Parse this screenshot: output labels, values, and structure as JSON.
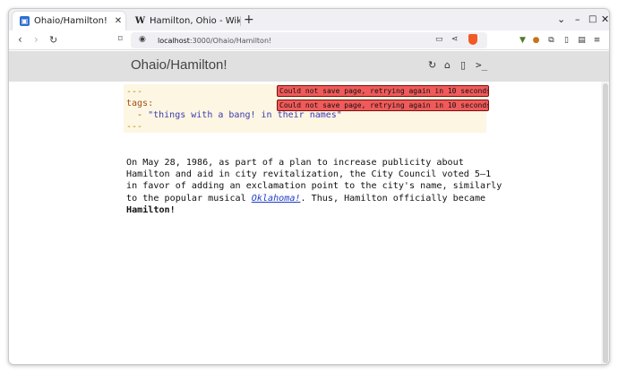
{
  "tabs": [
    {
      "title": "Ohaio/Hamilton!",
      "active": true
    },
    {
      "title": "Hamilton, Ohio - Wikipedia",
      "active": false
    }
  ],
  "window_controls": {
    "minimize": "–",
    "maximize": "□",
    "close": "✕",
    "dropdown": "⌄"
  },
  "address": {
    "host": "localhost",
    "path": ":3000/Ohaio/Hamilton!"
  },
  "app": {
    "title": "Ohaio/Hamilton!"
  },
  "frontmatter": {
    "open": "---",
    "key": "tags:",
    "item_prefix": "  - ",
    "item": "\"things with a bang! in their names\"",
    "close": "---"
  },
  "errors": [
    "Could not save page, retrying again in 10 seconds",
    "Could not save page, retrying again in 10 seconds"
  ],
  "article": {
    "before_link": "On May 28, 1986, as part of a plan to increase publicity about Hamilton and aid in city revitalization, the City Council voted 5–1 in favor of adding an exclamation point to the city's name, similarly to the popular musical ",
    "link": "Oklahoma!",
    "after_link": ". Thus, Hamilton officially became ",
    "bold": "Hamilton!"
  },
  "icons": {
    "accent": "#2e6fd1",
    "error_bg": "#f05a5a",
    "frontmatter_bg": "#fdf6e3"
  }
}
